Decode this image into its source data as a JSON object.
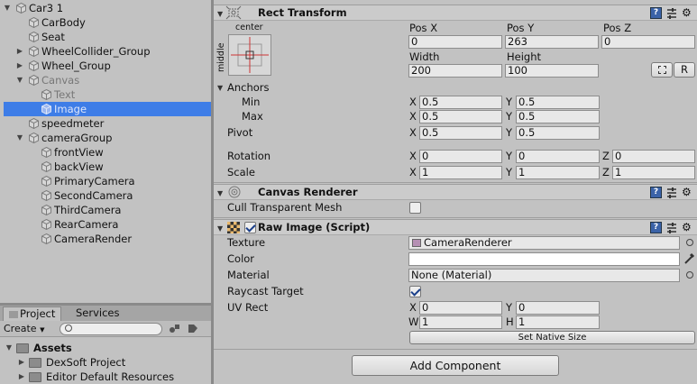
{
  "hierarchy": {
    "items": [
      {
        "label": "Car3 1",
        "fold": "▼",
        "indent": 0,
        "dim": false,
        "selected": false
      },
      {
        "label": "CarBody",
        "fold": "",
        "indent": 1,
        "dim": false,
        "selected": false
      },
      {
        "label": "Seat",
        "fold": "",
        "indent": 1,
        "dim": false,
        "selected": false
      },
      {
        "label": "WheelCollider_Group",
        "fold": "▶",
        "indent": 1,
        "dim": false,
        "selected": false
      },
      {
        "label": "Wheel_Group",
        "fold": "▶",
        "indent": 1,
        "dim": false,
        "selected": false
      },
      {
        "label": "Canvas",
        "fold": "▼",
        "indent": 1,
        "dim": true,
        "selected": false
      },
      {
        "label": "Text",
        "fold": "",
        "indent": 2,
        "dim": true,
        "selected": false
      },
      {
        "label": "Image",
        "fold": "",
        "indent": 2,
        "dim": true,
        "selected": true
      },
      {
        "label": "speedmeter",
        "fold": "",
        "indent": 1,
        "dim": false,
        "selected": false
      },
      {
        "label": "cameraGroup",
        "fold": "▼",
        "indent": 1,
        "dim": false,
        "selected": false
      },
      {
        "label": "frontView",
        "fold": "",
        "indent": 2,
        "dim": false,
        "selected": false
      },
      {
        "label": "backView",
        "fold": "",
        "indent": 2,
        "dim": false,
        "selected": false
      },
      {
        "label": "PrimaryCamera",
        "fold": "",
        "indent": 2,
        "dim": false,
        "selected": false
      },
      {
        "label": "SecondCamera",
        "fold": "",
        "indent": 2,
        "dim": false,
        "selected": false
      },
      {
        "label": "ThirdCamera",
        "fold": "",
        "indent": 2,
        "dim": false,
        "selected": false
      },
      {
        "label": "RearCamera",
        "fold": "",
        "indent": 2,
        "dim": false,
        "selected": false
      },
      {
        "label": "CameraRender",
        "fold": "",
        "indent": 2,
        "dim": false,
        "selected": false
      }
    ]
  },
  "project": {
    "tabs": {
      "project": "Project",
      "services": "Services"
    },
    "create_label": "Create",
    "search_placeholder": "",
    "assets": [
      {
        "label": "Assets",
        "fold": "▼",
        "bold": true
      },
      {
        "label": "DexSoft Project",
        "fold": "▶",
        "bold": false
      },
      {
        "label": "Editor Default Resources",
        "fold": "▶",
        "bold": false
      }
    ]
  },
  "rect_transform": {
    "title": "Rect Transform",
    "anchor_preset_h": "center",
    "anchor_preset_v": "middle",
    "pos_x_label": "Pos X",
    "pos_y_label": "Pos Y",
    "pos_z_label": "Pos Z",
    "pos_x": "0",
    "pos_y": "263",
    "pos_z": "0",
    "width_label": "Width",
    "height_label": "Height",
    "width": "200",
    "height": "100",
    "raw_button": "R",
    "anchors_label": "Anchors",
    "min_label": "Min",
    "max_label": "Max",
    "pivot_label": "Pivot",
    "rotation_label": "Rotation",
    "scale_label": "Scale",
    "x": "X",
    "y": "Y",
    "z": "Z",
    "min_x": "0.5",
    "min_y": "0.5",
    "max_x": "0.5",
    "max_y": "0.5",
    "pivot_x": "0.5",
    "pivot_y": "0.5",
    "rot_x": "0",
    "rot_y": "0",
    "rot_z": "0",
    "scale_x": "1",
    "scale_y": "1",
    "scale_z": "1"
  },
  "canvas_renderer": {
    "title": "Canvas Renderer",
    "cull_label": "Cull Transparent Mesh",
    "cull_checked": false
  },
  "raw_image": {
    "title": "Raw Image (Script)",
    "enabled": true,
    "texture_label": "Texture",
    "texture_value": "CameraRenderer",
    "color_label": "Color",
    "color_value": "#ffffff",
    "material_label": "Material",
    "material_value": "None (Material)",
    "raycast_label": "Raycast Target",
    "raycast_checked": true,
    "uvrect_label": "UV Rect",
    "uv_x": "0",
    "uv_y": "0",
    "uv_w": "1",
    "uv_h": "1",
    "w": "W",
    "h": "H",
    "native_size_button": "Set Native Size"
  },
  "add_component_button": "Add Component",
  "colors": {
    "selection": "#3e7de7",
    "panel": "#c2c2c2"
  }
}
